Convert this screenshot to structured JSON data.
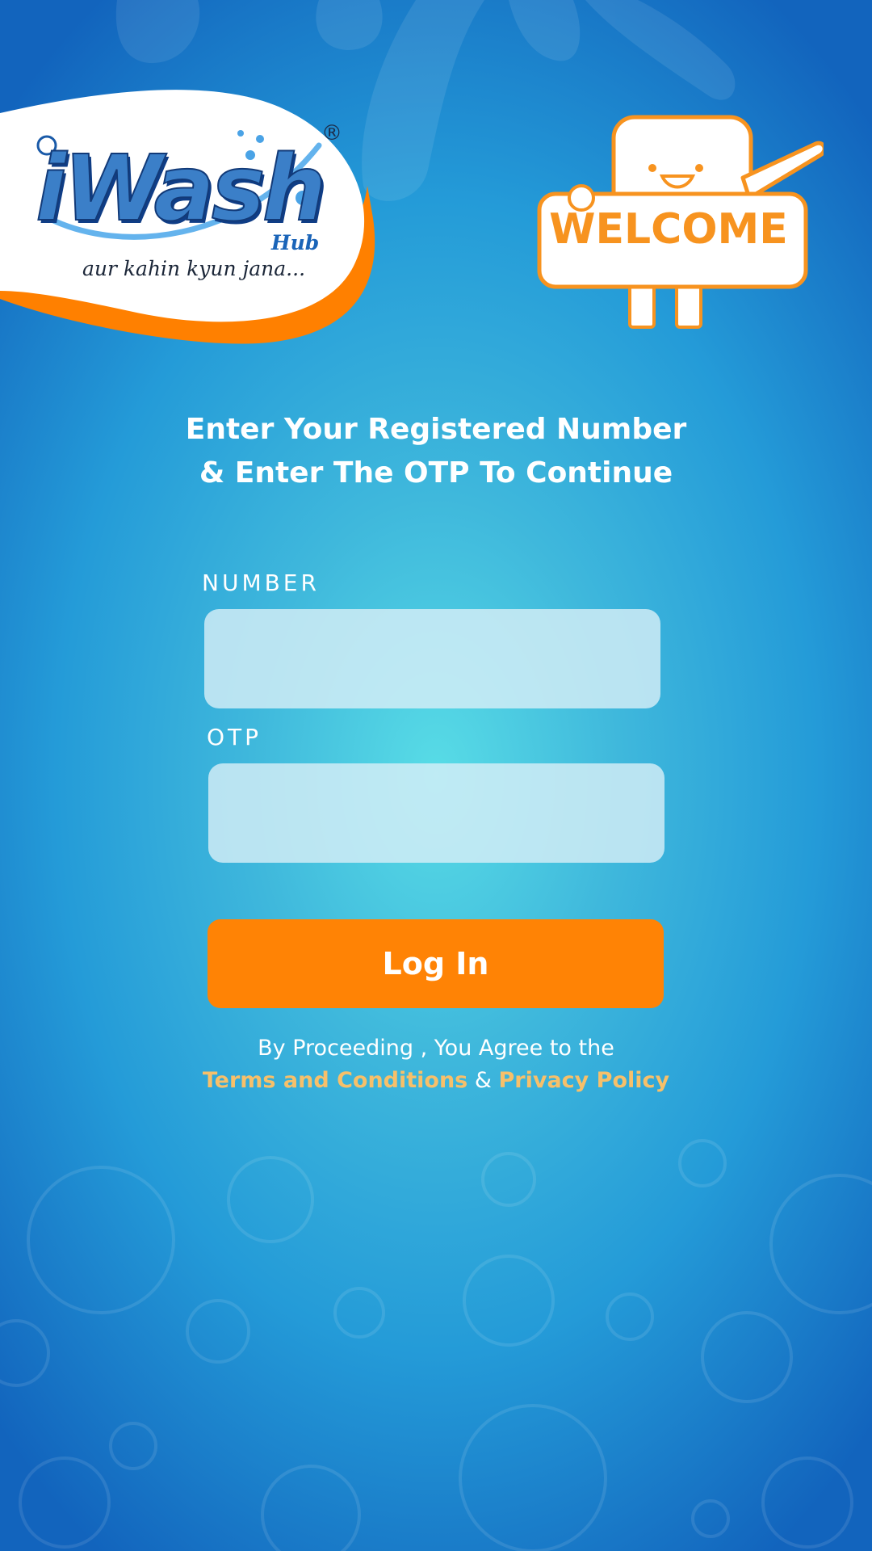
{
  "logo": {
    "brand": "iWash",
    "sub": "Hub",
    "registered": "®",
    "tagline": "aur kahin kyun jana..."
  },
  "mascot": {
    "sign_text": "WELCOME"
  },
  "heading": {
    "line1": "Enter Your Registered Number",
    "line2": "& Enter The OTP To Continue"
  },
  "form": {
    "number_label": "NUMBER",
    "number_value": "",
    "otp_label": "OTP",
    "otp_value": "",
    "login_label": "Log In"
  },
  "agreement": {
    "prefix": "By Proceeding , You Agree to the",
    "terms_label": "Terms and Conditions",
    "joiner": "&",
    "privacy_label": "Privacy Policy"
  },
  "colors": {
    "accent_orange": "#ff8305",
    "link_gold": "#f7c06a",
    "background_top": "#1264bd",
    "background_center": "#58dce6"
  }
}
